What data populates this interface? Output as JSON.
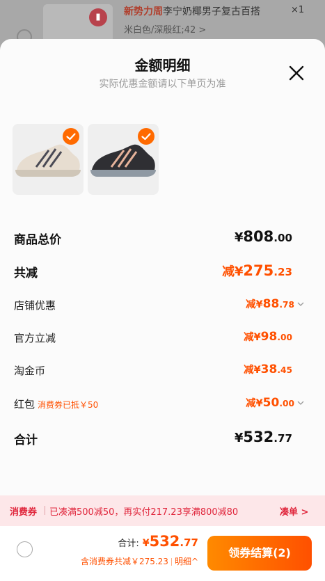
{
  "background_item": {
    "brand": "新势力周",
    "title": "李宁奶椰男子复古百搭",
    "spec": "米白色/深殷红;42 >",
    "qty": "×1"
  },
  "sheet": {
    "title": "金额明细",
    "subtitle": "实际优惠金额请以下单页为准"
  },
  "products": [
    {
      "name": "shoe-beige",
      "upper": "#e7ddd0",
      "stripe": "#4a4a55",
      "sole": "#cfc6b8",
      "selected": true
    },
    {
      "name": "shoe-black",
      "upper": "#2f2f33",
      "stripe": "#e6b39a",
      "sole": "#8f99a3",
      "selected": true
    }
  ],
  "rows": {
    "goods_total": {
      "label": "商品总价",
      "prefix": "¥",
      "int": "808",
      "dec": ".00"
    },
    "total_off": {
      "label": "共减",
      "prefix": "减¥",
      "int": "275",
      "dec": ".23"
    },
    "store": {
      "label": "店铺优惠",
      "prefix": "减¥",
      "int": "88",
      "dec": ".78"
    },
    "official": {
      "label": "官方立减",
      "prefix": "减¥",
      "int": "98",
      "dec": ".00"
    },
    "coin": {
      "label": "淘金币",
      "prefix": "减¥",
      "int": "38",
      "dec": ".45"
    },
    "redpack": {
      "label": "红包",
      "note": "消费券已抵￥50",
      "prefix": "减¥",
      "int": "50",
      "dec": ".00"
    },
    "subtotal": {
      "label": "合计",
      "prefix": "¥",
      "int": "532",
      "dec": ".77"
    }
  },
  "banner": {
    "tag": "消费券",
    "text": "已凑满500减50，再实付217.23享满800减80",
    "action": "凑单 >"
  },
  "footer": {
    "total_label": "合计:",
    "total_prefix": "¥",
    "total_int": "532",
    "total_dec": ".77",
    "sub_text": "含消费券共减￥275.23",
    "detail": "明细^",
    "checkout": "领券结算(2)"
  },
  "colors": {
    "accent": "#ff5000",
    "banner_text": "#e0263c"
  }
}
